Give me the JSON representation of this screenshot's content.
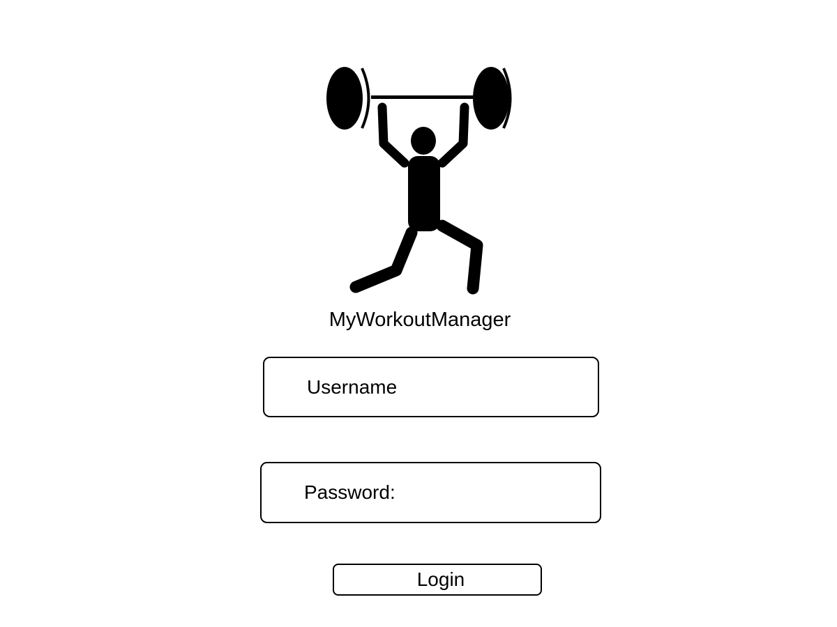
{
  "app": {
    "title": "MyWorkoutManager",
    "logo_icon": "weightlifter-icon"
  },
  "form": {
    "username_label": "Username",
    "password_label": "Password:",
    "login_label": "Login"
  },
  "colors": {
    "background": "#ffffff",
    "foreground": "#000000"
  }
}
